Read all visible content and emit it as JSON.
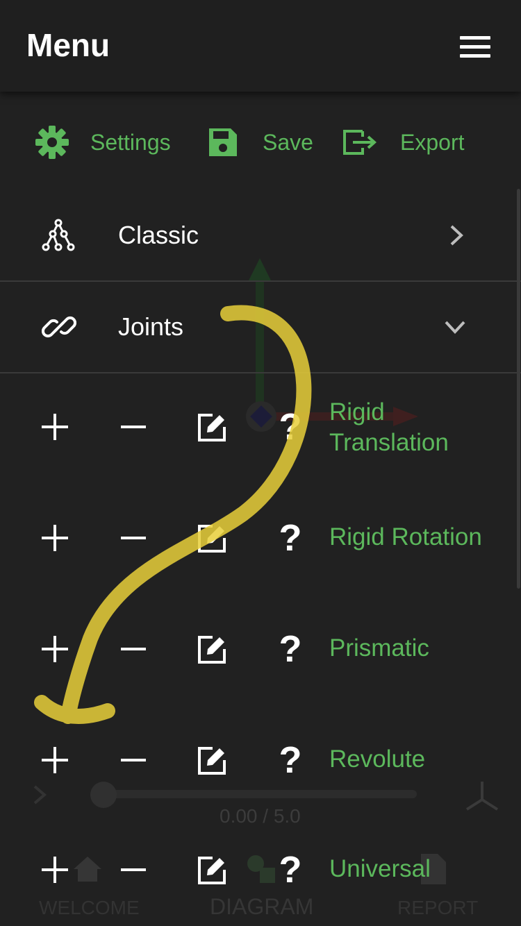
{
  "header": {
    "title": "Menu"
  },
  "actions": {
    "settings_label": "Settings",
    "save_label": "Save",
    "export_label": "Export"
  },
  "sections": [
    {
      "label": "Classic",
      "icon": "graph-icon",
      "expanded": false
    },
    {
      "label": "Joints",
      "icon": "link-icon",
      "expanded": true
    }
  ],
  "joints": [
    {
      "label": "Rigid Translation",
      "label_lines": [
        "Rigid",
        "Translation"
      ]
    },
    {
      "label": "Rigid Rotation"
    },
    {
      "label": "Prismatic"
    },
    {
      "label": "Revolute"
    },
    {
      "label": "Universal"
    }
  ],
  "joint_row_icons": [
    "plus-icon",
    "minus-icon",
    "edit-icon",
    "help-icon"
  ],
  "background": {
    "time_readout": "0.00 / 5.0",
    "nav": {
      "welcome": "WELCOME",
      "diagram": "DIAGRAM",
      "report": "REPORT"
    }
  },
  "colors": {
    "background": "#212121",
    "accent_green": "#5cb85c",
    "annotation_yellow": "#e8cf3a"
  }
}
